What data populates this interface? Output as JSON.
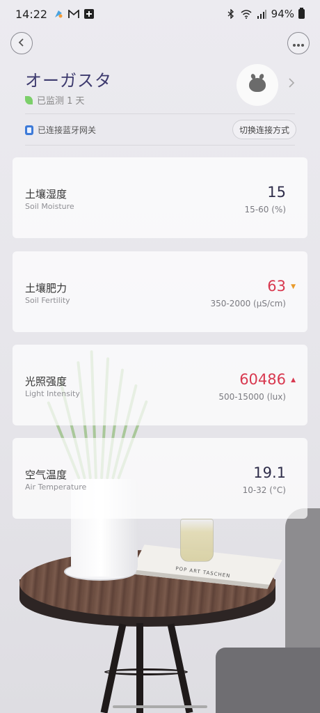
{
  "status_bar": {
    "time": "14:22",
    "battery": "94%",
    "left_icons": [
      "app-icon",
      "gmail-icon",
      "plus-icon"
    ],
    "right_icons": [
      "bluetooth-icon",
      "wifi-icon",
      "signal-icon",
      "battery-icon"
    ]
  },
  "device": {
    "name": "オーガスタ",
    "monitor_text": "已监测 1 天",
    "connection_text": "已连接蓝牙网关",
    "switch_label": "切换连接方式"
  },
  "metrics": [
    {
      "label": "土壤湿度",
      "sub": "Soil Moisture",
      "value": "15",
      "range": "15-60 (%)",
      "status": "normal",
      "trend": ""
    },
    {
      "label": "土壤肥力",
      "sub": "Soil Fertility",
      "value": "63",
      "range": "350-2000 (μS/cm)",
      "status": "alert",
      "trend": "▼"
    },
    {
      "label": "光照强度",
      "sub": "Light Intensity",
      "value": "60486",
      "range": "500-15000 (lux)",
      "status": "alert",
      "trend": "▲"
    },
    {
      "label": "空气温度",
      "sub": "Air Temperature",
      "value": "19.1",
      "range": "10-32 (°C)",
      "status": "normal",
      "trend": ""
    }
  ],
  "background": {
    "book_text": "POP ART    TASCHEN"
  },
  "colors": {
    "accent_text": "#3d3a6e",
    "alert": "#d8384f",
    "trend_down": "#e89a2a",
    "leaf": "#7ccf6a",
    "bluetooth": "#3d7ad8"
  }
}
